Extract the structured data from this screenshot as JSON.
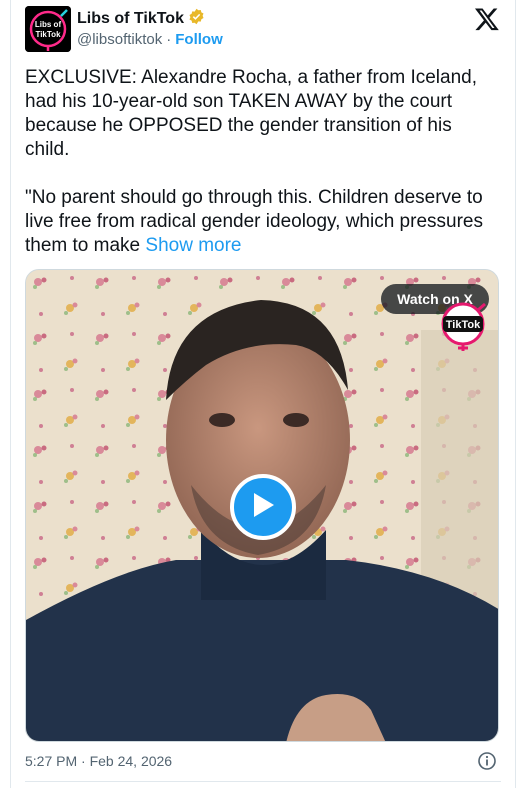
{
  "account": {
    "display_name": "Libs of TikTok",
    "handle": "@libsoftiktok",
    "separator": "·",
    "follow_label": "Follow",
    "avatar_text_line1": "Libs of",
    "avatar_text_line2": "TikTok",
    "verified": true,
    "verified_badge_color": "#e8b829"
  },
  "brand_icon": "x-logo-icon",
  "tweet": {
    "text": "EXCLUSIVE: Alexandre Rocha, a father from Iceland, had his 10-year-old son TAKEN AWAY by the court because he OPPOSED the gender transition of his child.\n\n\"No parent should go through this. Children deserve to live free from radical gender ideology, which pressures them to make ",
    "show_more_label": "Show more"
  },
  "media": {
    "watch_label": "Watch on X",
    "watermark_text": "TikTok",
    "play_icon": "play-icon",
    "play_color": "#1d9bf0"
  },
  "footer": {
    "timestamp": "5:27 PM · Feb 24, 2026",
    "info_icon": "info-icon"
  },
  "colors": {
    "link": "#1d9bf0",
    "secondary_text": "#536471",
    "primary_text": "#0f1419"
  }
}
